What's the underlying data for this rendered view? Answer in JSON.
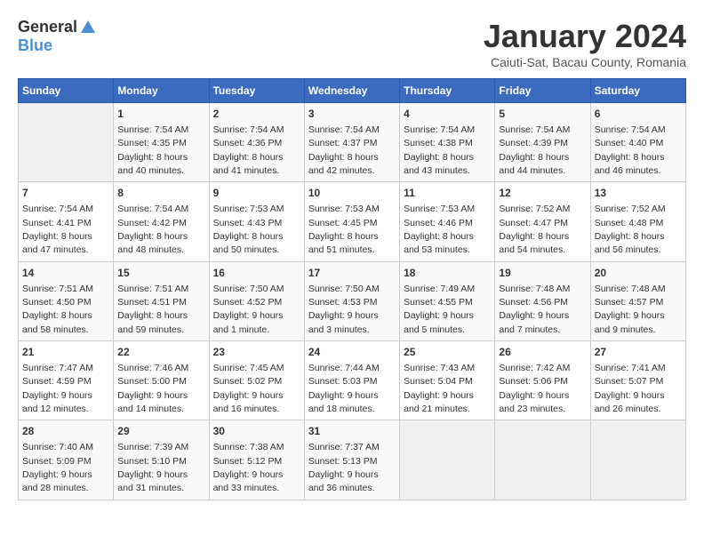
{
  "header": {
    "logo_general": "General",
    "logo_blue": "Blue",
    "month_title": "January 2024",
    "subtitle": "Caiuti-Sat, Bacau County, Romania"
  },
  "weekdays": [
    "Sunday",
    "Monday",
    "Tuesday",
    "Wednesday",
    "Thursday",
    "Friday",
    "Saturday"
  ],
  "weeks": [
    [
      {
        "day": "",
        "info": ""
      },
      {
        "day": "1",
        "info": "Sunrise: 7:54 AM\nSunset: 4:35 PM\nDaylight: 8 hours\nand 40 minutes."
      },
      {
        "day": "2",
        "info": "Sunrise: 7:54 AM\nSunset: 4:36 PM\nDaylight: 8 hours\nand 41 minutes."
      },
      {
        "day": "3",
        "info": "Sunrise: 7:54 AM\nSunset: 4:37 PM\nDaylight: 8 hours\nand 42 minutes."
      },
      {
        "day": "4",
        "info": "Sunrise: 7:54 AM\nSunset: 4:38 PM\nDaylight: 8 hours\nand 43 minutes."
      },
      {
        "day": "5",
        "info": "Sunrise: 7:54 AM\nSunset: 4:39 PM\nDaylight: 8 hours\nand 44 minutes."
      },
      {
        "day": "6",
        "info": "Sunrise: 7:54 AM\nSunset: 4:40 PM\nDaylight: 8 hours\nand 46 minutes."
      }
    ],
    [
      {
        "day": "7",
        "info": "Sunrise: 7:54 AM\nSunset: 4:41 PM\nDaylight: 8 hours\nand 47 minutes."
      },
      {
        "day": "8",
        "info": "Sunrise: 7:54 AM\nSunset: 4:42 PM\nDaylight: 8 hours\nand 48 minutes."
      },
      {
        "day": "9",
        "info": "Sunrise: 7:53 AM\nSunset: 4:43 PM\nDaylight: 8 hours\nand 50 minutes."
      },
      {
        "day": "10",
        "info": "Sunrise: 7:53 AM\nSunset: 4:45 PM\nDaylight: 8 hours\nand 51 minutes."
      },
      {
        "day": "11",
        "info": "Sunrise: 7:53 AM\nSunset: 4:46 PM\nDaylight: 8 hours\nand 53 minutes."
      },
      {
        "day": "12",
        "info": "Sunrise: 7:52 AM\nSunset: 4:47 PM\nDaylight: 8 hours\nand 54 minutes."
      },
      {
        "day": "13",
        "info": "Sunrise: 7:52 AM\nSunset: 4:48 PM\nDaylight: 8 hours\nand 56 minutes."
      }
    ],
    [
      {
        "day": "14",
        "info": "Sunrise: 7:51 AM\nSunset: 4:50 PM\nDaylight: 8 hours\nand 58 minutes."
      },
      {
        "day": "15",
        "info": "Sunrise: 7:51 AM\nSunset: 4:51 PM\nDaylight: 8 hours\nand 59 minutes."
      },
      {
        "day": "16",
        "info": "Sunrise: 7:50 AM\nSunset: 4:52 PM\nDaylight: 9 hours\nand 1 minute."
      },
      {
        "day": "17",
        "info": "Sunrise: 7:50 AM\nSunset: 4:53 PM\nDaylight: 9 hours\nand 3 minutes."
      },
      {
        "day": "18",
        "info": "Sunrise: 7:49 AM\nSunset: 4:55 PM\nDaylight: 9 hours\nand 5 minutes."
      },
      {
        "day": "19",
        "info": "Sunrise: 7:48 AM\nSunset: 4:56 PM\nDaylight: 9 hours\nand 7 minutes."
      },
      {
        "day": "20",
        "info": "Sunrise: 7:48 AM\nSunset: 4:57 PM\nDaylight: 9 hours\nand 9 minutes."
      }
    ],
    [
      {
        "day": "21",
        "info": "Sunrise: 7:47 AM\nSunset: 4:59 PM\nDaylight: 9 hours\nand 12 minutes."
      },
      {
        "day": "22",
        "info": "Sunrise: 7:46 AM\nSunset: 5:00 PM\nDaylight: 9 hours\nand 14 minutes."
      },
      {
        "day": "23",
        "info": "Sunrise: 7:45 AM\nSunset: 5:02 PM\nDaylight: 9 hours\nand 16 minutes."
      },
      {
        "day": "24",
        "info": "Sunrise: 7:44 AM\nSunset: 5:03 PM\nDaylight: 9 hours\nand 18 minutes."
      },
      {
        "day": "25",
        "info": "Sunrise: 7:43 AM\nSunset: 5:04 PM\nDaylight: 9 hours\nand 21 minutes."
      },
      {
        "day": "26",
        "info": "Sunrise: 7:42 AM\nSunset: 5:06 PM\nDaylight: 9 hours\nand 23 minutes."
      },
      {
        "day": "27",
        "info": "Sunrise: 7:41 AM\nSunset: 5:07 PM\nDaylight: 9 hours\nand 26 minutes."
      }
    ],
    [
      {
        "day": "28",
        "info": "Sunrise: 7:40 AM\nSunset: 5:09 PM\nDaylight: 9 hours\nand 28 minutes."
      },
      {
        "day": "29",
        "info": "Sunrise: 7:39 AM\nSunset: 5:10 PM\nDaylight: 9 hours\nand 31 minutes."
      },
      {
        "day": "30",
        "info": "Sunrise: 7:38 AM\nSunset: 5:12 PM\nDaylight: 9 hours\nand 33 minutes."
      },
      {
        "day": "31",
        "info": "Sunrise: 7:37 AM\nSunset: 5:13 PM\nDaylight: 9 hours\nand 36 minutes."
      },
      {
        "day": "",
        "info": ""
      },
      {
        "day": "",
        "info": ""
      },
      {
        "day": "",
        "info": ""
      }
    ]
  ]
}
